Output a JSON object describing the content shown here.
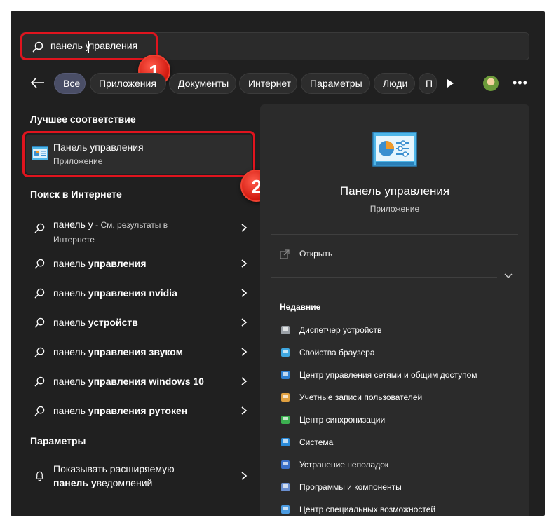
{
  "search": {
    "query_before": "панель у",
    "query_after": "правления"
  },
  "badges": [
    "1",
    "2"
  ],
  "filters": [
    "Все",
    "Приложения",
    "Документы",
    "Интернет",
    "Параметры",
    "Люди",
    "П"
  ],
  "sections": {
    "best_match": "Лучшее соответствие",
    "web_search": "Поиск в Интернете",
    "settings": "Параметры"
  },
  "best_match": {
    "title": "Панель управления",
    "subtitle": "Приложение"
  },
  "web_results": [
    {
      "prefix": "панель у",
      "suffix": " - См. результаты в",
      "line2": "Интернете"
    },
    {
      "prefix": "панель ",
      "bold": "управления"
    },
    {
      "prefix": "панель ",
      "bold": "управления nvidia"
    },
    {
      "prefix": "панель ",
      "bold": "устройств"
    },
    {
      "prefix": "панель ",
      "bold": "управления звуком"
    },
    {
      "prefix": "панель ",
      "bold": "управления windows 10"
    },
    {
      "prefix": "панель ",
      "bold": "управления рутокен"
    }
  ],
  "settings_result": {
    "line1": "Показывать расширяемую",
    "line2_bold": "панель у",
    "line2_rest": "ведомлений"
  },
  "detail": {
    "title": "Панель управления",
    "subtitle": "Приложение",
    "open_label": "Открыть",
    "recent_header": "Недавние",
    "recent": [
      {
        "label": "Диспетчер устройств",
        "icon": "device-manager-icon"
      },
      {
        "label": "Свойства браузера",
        "icon": "browser-properties-icon"
      },
      {
        "label": "Центр управления сетями и общим доступом",
        "icon": "network-center-icon"
      },
      {
        "label": "Учетные записи пользователей",
        "icon": "user-accounts-icon"
      },
      {
        "label": "Центр синхронизации",
        "icon": "sync-center-icon"
      },
      {
        "label": "Система",
        "icon": "system-icon"
      },
      {
        "label": "Устранение неполадок",
        "icon": "troubleshoot-icon"
      },
      {
        "label": "Программы и компоненты",
        "icon": "programs-icon"
      },
      {
        "label": "Центр специальных возможностей",
        "icon": "accessibility-icon"
      }
    ]
  },
  "colors": {
    "background": "#202020",
    "panel": "#2b2b2b",
    "accent_chip": "#4a4e66",
    "highlight": "#e0141e"
  }
}
